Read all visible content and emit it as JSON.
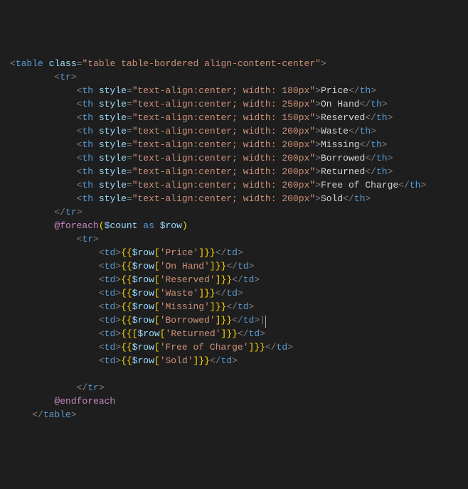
{
  "code": {
    "tableTag": "table",
    "tableClassAttr": "class",
    "tableClassValue": "\"table table-bordered align-content-center\"",
    "trTag": "tr",
    "thTag": "th",
    "tdTag": "td",
    "styleAttr": "style",
    "headers": [
      {
        "style": "\"text-align:center; width: 180px\"",
        "text": "Price"
      },
      {
        "style": "\"text-align:center; width: 250px\"",
        "text": "On Hand"
      },
      {
        "style": "\"text-align:center; width: 150px\"",
        "text": "Reserved"
      },
      {
        "style": "\"text-align:center; width: 200px\"",
        "text": "Waste"
      },
      {
        "style": "\"text-align:center; width: 200px\"",
        "text": "Missing"
      },
      {
        "style": "\"text-align:center; width: 200px\"",
        "text": "Borrowed"
      },
      {
        "style": "\"text-align:center; width: 200px\"",
        "text": "Returned"
      },
      {
        "style": "\"text-align:center; width: 200px\"",
        "text": "Free of Charge"
      },
      {
        "style": "\"text-align:center; width: 200px\"",
        "text": "Sold"
      }
    ],
    "foreachStart": "@foreach",
    "foreachArgsOpen": "(",
    "foreachVar1": "$count",
    "foreachAs": "as",
    "foreachVar2": "$row",
    "foreachArgsClose": ")",
    "rowVar": "$row",
    "cells": [
      {
        "key": "'Price'"
      },
      {
        "key": "'On Hand'"
      },
      {
        "key": "'Reserved'"
      },
      {
        "key": "'Waste'"
      },
      {
        "key": "'Missing'"
      },
      {
        "key": "'Borrowed'",
        "cursor": true
      },
      {
        "key": "'Returned'",
        "leadingBracket": true
      },
      {
        "key": "'Free of Charge'"
      },
      {
        "key": "'Sold'"
      }
    ],
    "endforeach": "@endforeach"
  }
}
